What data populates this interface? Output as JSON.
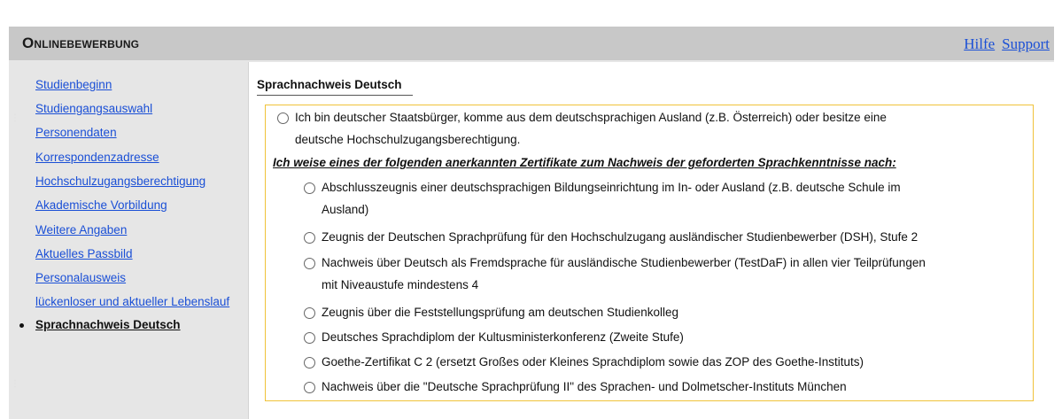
{
  "header": {
    "title": "Onlinebewerbung",
    "links": [
      "Hilfe",
      "Support"
    ]
  },
  "sidebar": {
    "items": [
      {
        "label": "Studienbeginn",
        "active": false
      },
      {
        "label": "Studiengangsauswahl",
        "active": false
      },
      {
        "label": "Personendaten",
        "active": false
      },
      {
        "label": "Korrespondenzadresse",
        "active": false
      },
      {
        "label": "Hochschulzugangsberechtigung",
        "active": false
      },
      {
        "label": "Akademische Vorbildung",
        "active": false
      },
      {
        "label": "Weitere Angaben",
        "active": false
      },
      {
        "label": "Aktuelles Passbild",
        "active": false
      },
      {
        "label": "Personalausweis",
        "active": false
      },
      {
        "label": "lückenloser und aktueller Lebenslauf",
        "active": false
      },
      {
        "label": "Sprachnachweis Deutsch",
        "active": true
      }
    ]
  },
  "main": {
    "section_title": "Sprachnachweis Deutsch",
    "top_option": {
      "line1": "Ich bin deutscher Staatsbürger, komme aus dem deutschsprachigen Ausland (z.B. Österreich) oder besitze eine",
      "line2": "deutsche Hochschulzugangsberechtigung."
    },
    "certificates_heading": "Ich weise eines der folgenden anerkannten Zertifikate zum Nachweis der geforderten Sprachkenntnisse nach:",
    "options": [
      {
        "line1": "Abschlusszeugnis einer deutschsprachigen Bildungseinrichtung im In- oder Ausland (z.B. deutsche Schule im",
        "line2": "Ausland)"
      },
      {
        "line1": "Zeugnis der Deutschen Sprachprüfung für den Hochschulzugang ausländischer Studienbewerber (DSH), Stufe 2",
        "line2": ""
      },
      {
        "line1": "Nachweis über Deutsch als Fremdsprache für ausländische Studienbewerber (TestDaF) in allen vier Teilprüfungen",
        "line2": "mit Niveaustufe mindestens 4"
      },
      {
        "line1": "Zeugnis über die Feststellungsprüfung am deutschen Studienkolleg",
        "line2": ""
      },
      {
        "line1": "Deutsches Sprachdiplom der Kultusministerkonferenz (Zweite Stufe)",
        "line2": ""
      },
      {
        "line1": "Goethe-Zertifikat C 2 (ersetzt Großes oder Kleines Sprachdiplom sowie das ZOP des Goethe-Instituts)",
        "line2": ""
      },
      {
        "line1": "Nachweis über die \"Deutsche Sprachprüfung II\" des Sprachen- und Dolmetscher-Instituts München",
        "line2": ""
      }
    ]
  }
}
